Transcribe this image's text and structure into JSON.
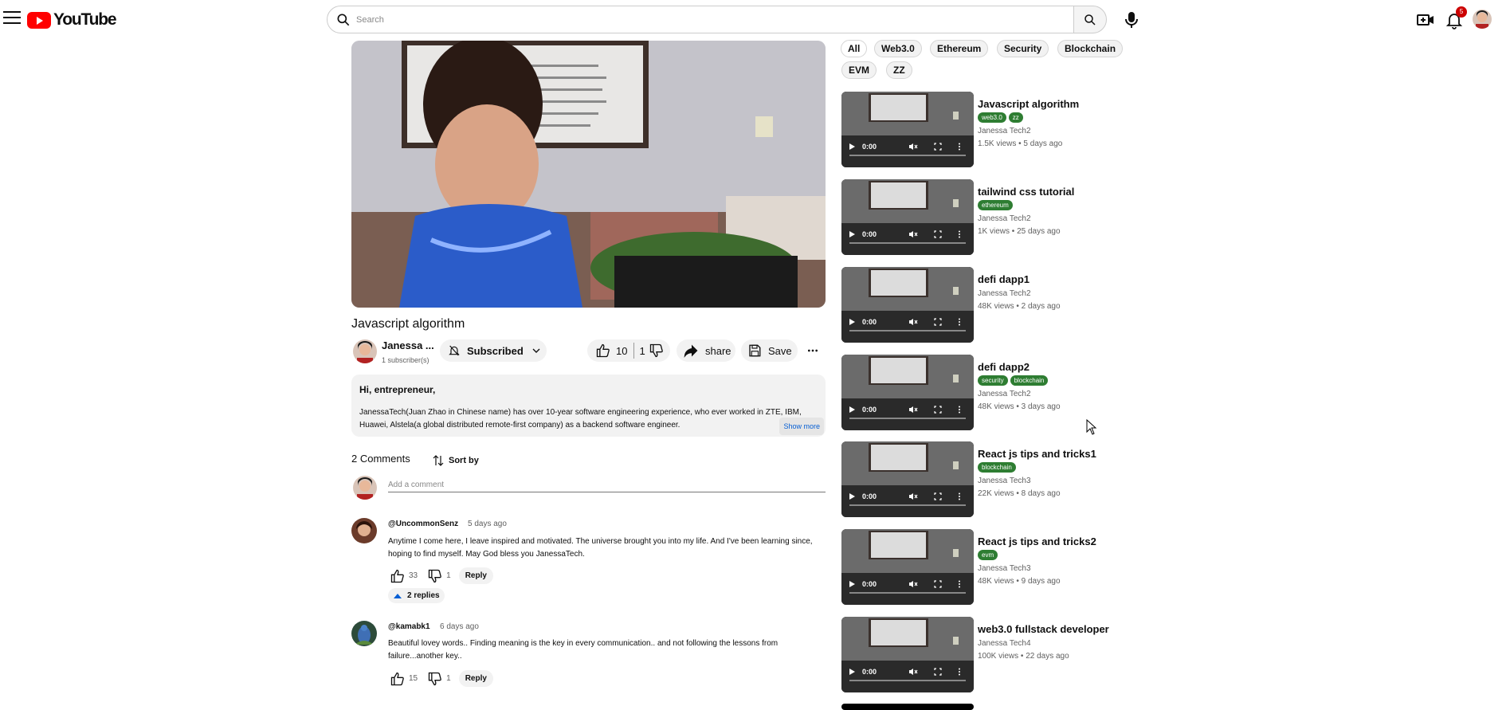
{
  "header": {
    "logo_text": "YouTube",
    "search_placeholder": "Search",
    "notification_count": "5"
  },
  "video": {
    "title": "Javascript algorithm",
    "channel_name": "Janessa ...",
    "subscribers": "1 subscriber(s)",
    "subscribed_label": "Subscribed",
    "likes": "10",
    "dislikes": "1",
    "share_label": "share",
    "save_label": "Save"
  },
  "description": {
    "greeting": "Hi, entrepreneur,",
    "body": "JanessaTech(Juan Zhao in Chinese name) has over 10-year software engineering experience, who ever worked in ZTE, IBM, Huawei, Alstela(a global distributed remote-first company) as a backend software engineer.",
    "show_more": "Show more"
  },
  "comments": {
    "count_label": "2 Comments",
    "sort_label": "Sort by",
    "add_placeholder": "Add a comment",
    "items": [
      {
        "author": "@UncommonSenz",
        "time": "5 days ago",
        "text": "Anytime I come here, I leave inspired and motivated. The universe brought you into my life. And I've been learning since, hoping to find myself. May God bless you JanessaTech.",
        "likes": "33",
        "dislikes": "1",
        "reply": "Reply",
        "replies": "2 replies"
      },
      {
        "author": "@kamabk1",
        "time": "6 days ago",
        "text": "Beautiful lovey words.. Finding meaning is the key in every communication.. and not following the lessons from failure...another key..",
        "likes": "15",
        "dislikes": "1",
        "reply": "Reply"
      }
    ]
  },
  "chips": [
    "All",
    "Web3.0",
    "Ethereum",
    "Security",
    "Blockchain",
    "EVM",
    "ZZ"
  ],
  "recommendations": [
    {
      "title": "Javascript algorithm",
      "tags": [
        "web3.0",
        "zz"
      ],
      "channel": "Janessa Tech2",
      "meta": "1.5K views • 5 days ago",
      "time": "0:00"
    },
    {
      "title": "tailwind css tutorial",
      "tags": [
        "ethereum"
      ],
      "channel": "Janessa Tech2",
      "meta": "1K views • 25 days ago",
      "time": "0:00"
    },
    {
      "title": "defi dapp1",
      "tags": [],
      "channel": "Janessa Tech2",
      "meta": "48K views • 2 days ago",
      "time": "0:00"
    },
    {
      "title": "defi dapp2",
      "tags": [
        "security",
        "blockchain"
      ],
      "channel": "Janessa Tech2",
      "meta": "48K views • 3 days ago",
      "time": "0:00"
    },
    {
      "title": "React js tips and tricks1",
      "tags": [
        "blockchain"
      ],
      "channel": "Janessa Tech3",
      "meta": "22K views • 8 days ago",
      "time": "0:00"
    },
    {
      "title": "React js tips and tricks2",
      "tags": [
        "evm"
      ],
      "channel": "Janessa Tech3",
      "meta": "48K views • 9 days ago",
      "time": "0:00"
    },
    {
      "title": "web3.0 fullstack developer",
      "tags": [],
      "channel": "Janessa Tech4",
      "meta": "100K views • 22 days ago",
      "time": "0:00"
    }
  ]
}
